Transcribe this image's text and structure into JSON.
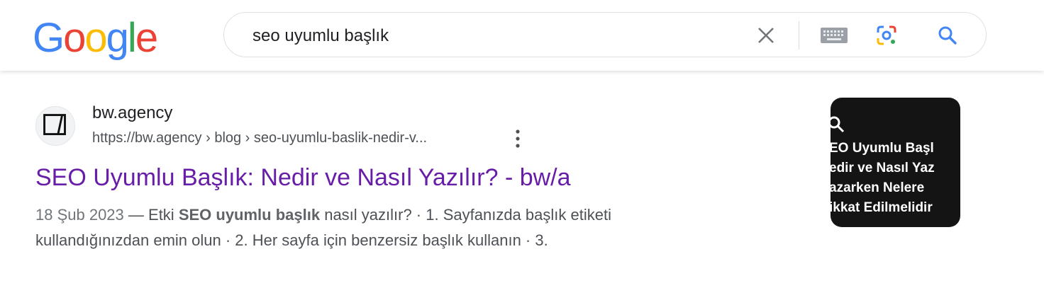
{
  "header": {
    "logo": {
      "letters": [
        "G",
        "o",
        "o",
        "g",
        "l",
        "e"
      ],
      "colors": [
        "#4285F4",
        "#EA4335",
        "#FBBC05",
        "#4285F4",
        "#34A853",
        "#EA4335"
      ]
    },
    "search": {
      "query": "seo uyumlu başlık"
    },
    "icons": {
      "clear": "close-icon",
      "keyboard": "keyboard-icon",
      "lens": "camera-lens-icon",
      "search": "search-icon"
    }
  },
  "result": {
    "site_name": "bw.agency",
    "url": "https://bw.agency › blog › seo-uyumlu-baslik-nedir-v...",
    "title": "SEO Uyumlu Başlık: Nedir ve Nasıl Yazılır? - bw/a",
    "snippet": {
      "date": "18 Şub 2023",
      "dash": " — ",
      "pre": "Etki ",
      "bold": "SEO uyumlu başlık",
      "post1": " nasıl yazılır? · 1. Sayfanızda başlık etiketi",
      "line2": "kullandığınızdan emin olun · 2. Her sayfa için benzersiz başlık kullanın · 3."
    },
    "thumbnail": {
      "lines": [
        "EO Uyumlu Başl",
        "edir ve Nasıl Yaz",
        "azarken Nelere",
        "ikkat Edilmelidir"
      ]
    }
  },
  "colors": {
    "link_visited": "#681da8",
    "text": "#202124",
    "muted": "#4d5156",
    "blue": "#4285F4"
  }
}
